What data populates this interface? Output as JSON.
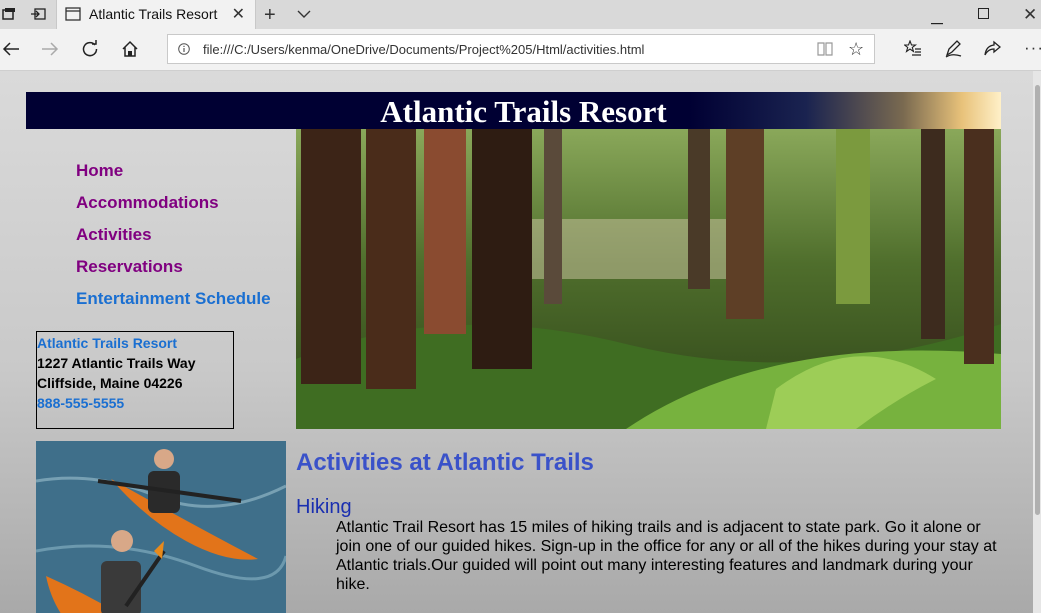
{
  "browser": {
    "tab_title": "Atlantic Trails Resort",
    "url": "file:///C:/Users/kenma/OneDrive/Documents/Project%205/Html/activities.html"
  },
  "page": {
    "banner_title": "Atlantic Trails Resort",
    "nav": [
      {
        "label": "Home"
      },
      {
        "label": "Accommodations"
      },
      {
        "label": "Activities"
      },
      {
        "label": "Reservations"
      },
      {
        "label": "Entertainment Schedule"
      }
    ],
    "address": {
      "name": "Atlantic Trails Resort",
      "street": "1227 Atlantic Trails Way",
      "city": "Cliffside, Maine 04226",
      "phone": "888-555-5555"
    },
    "heading": "Activities at Atlantic Trails",
    "section_title": "Hiking",
    "section_text": "Atlantic Trail Resort has 15 miles of hiking trails and is adjacent to state park. Go it alone or join one of our guided hikes. Sign-up in the office for any or all of the hikes during your stay at Atlantic trials.Our guided will point out many interesting features and landmark during your hike."
  },
  "colors": {
    "visited_link": "#800080",
    "link": "#1a6fd1",
    "heading": "#3a52c9",
    "banner_bg": "#000033"
  }
}
